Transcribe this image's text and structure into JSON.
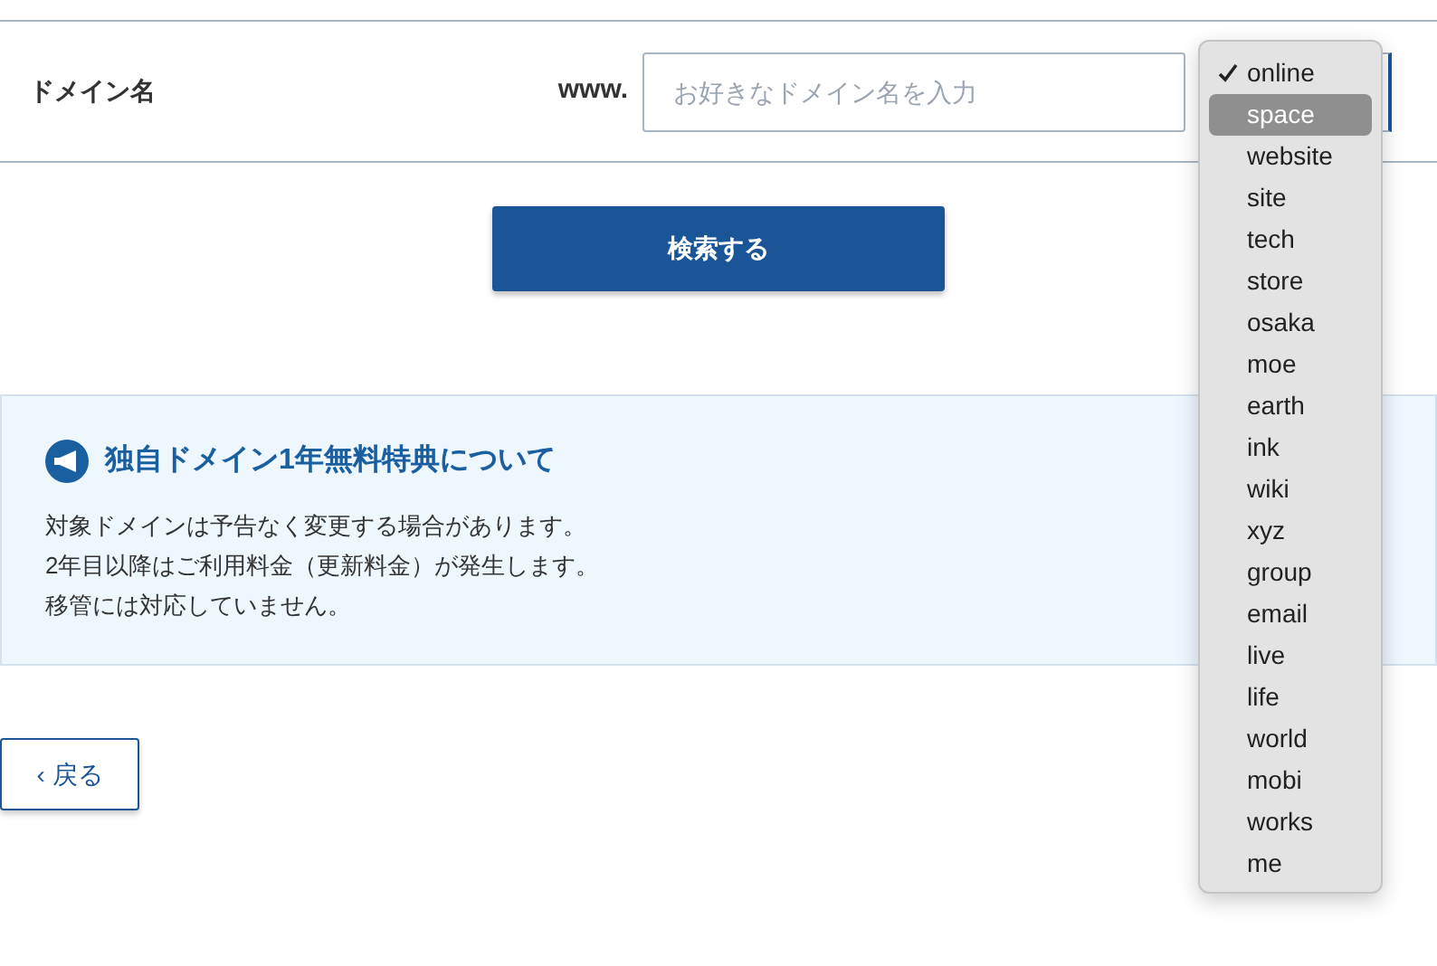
{
  "domain_row": {
    "label": "ドメイン名",
    "prefix": "www.",
    "input": {
      "placeholder": "お好きなドメイン名を入力"
    }
  },
  "tld_dropdown": {
    "options": [
      {
        "label": "online",
        "selected": true,
        "highlighted": false
      },
      {
        "label": "space",
        "selected": false,
        "highlighted": true
      },
      {
        "label": "website",
        "selected": false,
        "highlighted": false
      },
      {
        "label": "site",
        "selected": false,
        "highlighted": false
      },
      {
        "label": "tech",
        "selected": false,
        "highlighted": false
      },
      {
        "label": "store",
        "selected": false,
        "highlighted": false
      },
      {
        "label": "osaka",
        "selected": false,
        "highlighted": false
      },
      {
        "label": "moe",
        "selected": false,
        "highlighted": false
      },
      {
        "label": "earth",
        "selected": false,
        "highlighted": false
      },
      {
        "label": "ink",
        "selected": false,
        "highlighted": false
      },
      {
        "label": "wiki",
        "selected": false,
        "highlighted": false
      },
      {
        "label": "xyz",
        "selected": false,
        "highlighted": false
      },
      {
        "label": "group",
        "selected": false,
        "highlighted": false
      },
      {
        "label": "email",
        "selected": false,
        "highlighted": false
      },
      {
        "label": "live",
        "selected": false,
        "highlighted": false
      },
      {
        "label": "life",
        "selected": false,
        "highlighted": false
      },
      {
        "label": "world",
        "selected": false,
        "highlighted": false
      },
      {
        "label": "mobi",
        "selected": false,
        "highlighted": false
      },
      {
        "label": "works",
        "selected": false,
        "highlighted": false
      },
      {
        "label": "me",
        "selected": false,
        "highlighted": false
      }
    ]
  },
  "search_button": "検索する",
  "notice": {
    "title": "独自ドメイン1年無料特典について",
    "lines": [
      "対象ドメインは予告なく変更する場合があります。",
      "2年目以降はご利用料金（更新料金）が発生します。",
      "移管には対応していません。"
    ]
  },
  "back_button": {
    "caret": "‹",
    "label": "戻る"
  }
}
